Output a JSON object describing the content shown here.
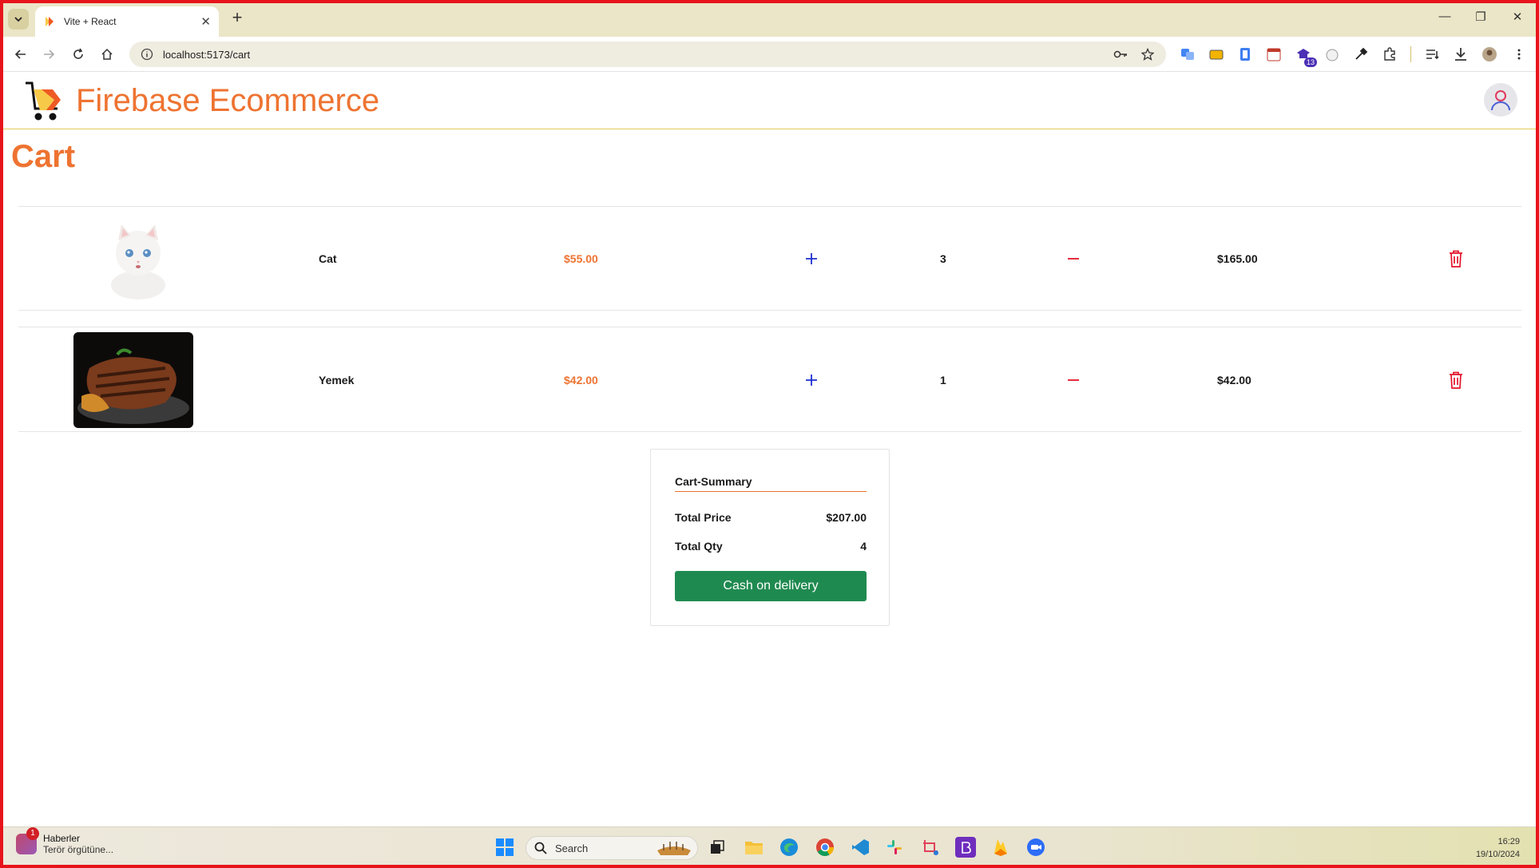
{
  "browser": {
    "tab_title": "Vite + React",
    "url": "localhost:5173/cart",
    "extension_badge": "13"
  },
  "app": {
    "brand": "Firebase Ecommerce",
    "accent_color": "#ee7331"
  },
  "page": {
    "title": "Cart"
  },
  "cart": {
    "items": [
      {
        "name": "Cat",
        "price": "$55.00",
        "qty": "3",
        "total": "$165.00",
        "image": "cat-photo"
      },
      {
        "name": "Yemek",
        "price": "$42.00",
        "qty": "1",
        "total": "$42.00",
        "image": "steak-photo"
      }
    ]
  },
  "summary": {
    "title": "Cart-Summary",
    "total_price_label": "Total Price",
    "total_price": "$207.00",
    "total_qty_label": "Total Qty",
    "total_qty": "4",
    "checkout_label": "Cash on delivery",
    "button_color": "#1f8a50"
  },
  "taskbar": {
    "news_title": "Haberler",
    "news_subtitle": "Terör örgütüne...",
    "news_badge": "1",
    "search_placeholder": "Search",
    "time": "16:29",
    "date": "19/10/2024"
  }
}
